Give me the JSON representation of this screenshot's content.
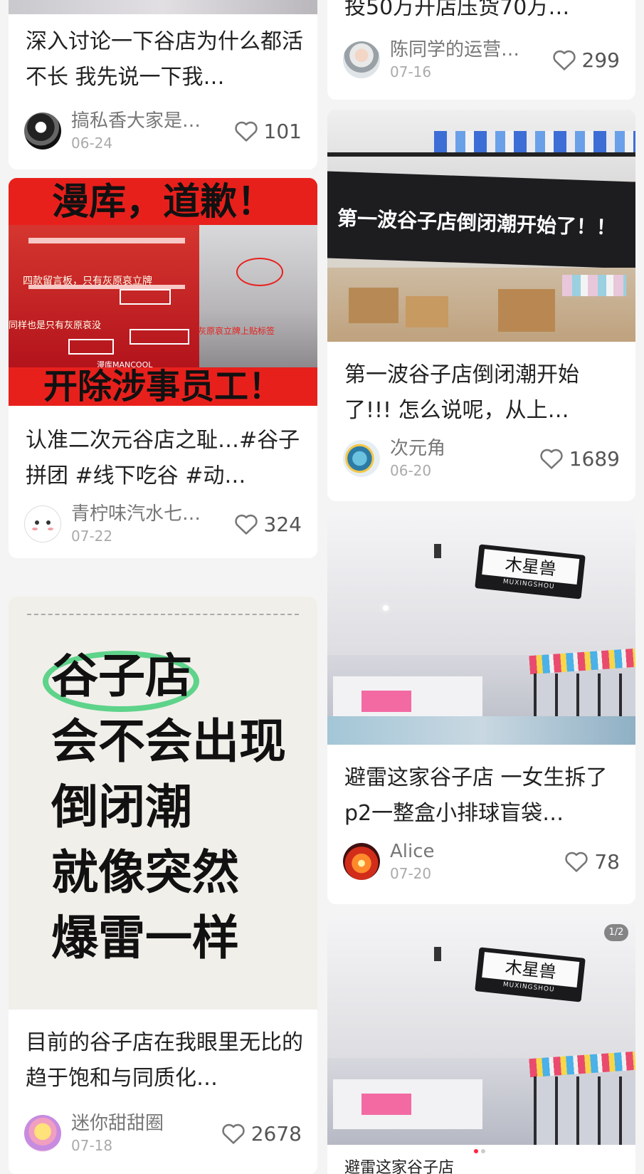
{
  "cards": [
    {
      "title": "深入讨论一下谷店为什么都活不长 我先说一下我…",
      "author": "搞私香大家是…",
      "date": "06-24",
      "likes": "101"
    },
    {
      "title": "认准二次元谷店之耻…#谷子拼团 #线下吃谷 #动…",
      "author": "青柠味汽水七…",
      "date": "07-22",
      "likes": "324",
      "cover_top_text": "漫库，道歉！",
      "cover_bottom_text": "开除涉事员工！",
      "cover_caption_1": "四款留言板，只有灰原哀立牌",
      "cover_caption_2": "同样也是只有灰原哀没",
      "cover_caption_3": "灰原哀立牌上贴标签",
      "cover_brand": "漫库MANCOOL"
    },
    {
      "title": "目前的谷子店在我眼里无比的趋于饱和与同质化…",
      "author": "迷你甜甜圈",
      "date": "07-18",
      "likes": "2678",
      "cover_lines": [
        "谷子店",
        "会不会出现",
        "倒闭潮",
        "就像突然",
        "爆雷一样"
      ]
    },
    {
      "title_partial": "投50万开店压货70万…",
      "author": "陈同学的运营…",
      "date": "07-16",
      "likes": "299"
    },
    {
      "title": "第一波谷子店倒闭潮开始了!!!  怎么说呢，从上…",
      "author": "次元角",
      "date": "06-20",
      "likes": "1689",
      "cover_banner": "第一波谷子店倒闭潮开始了！！"
    },
    {
      "title": "避雷这家谷子店 一女生拆了p2一整盒小排球盲袋…",
      "author": "Alice",
      "date": "07-20",
      "likes": "78",
      "store_sign": "木星兽",
      "store_sign_sub": "MUXINGSHOU"
    },
    {
      "page_indicator": "1/2",
      "store_sign": "木星兽",
      "store_sign_sub": "MUXINGSHOU",
      "title_partial": "避雷这家谷子店"
    }
  ],
  "icons": {
    "like": "heart-outline-icon"
  },
  "colors": {
    "banner_red": "#e8201c",
    "highlight_green": "#5ed38a"
  }
}
